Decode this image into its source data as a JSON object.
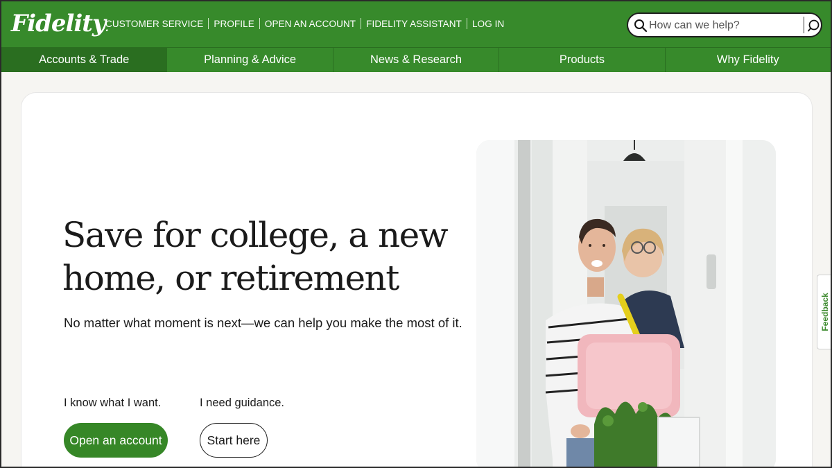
{
  "brand": {
    "logo_text": "Fidelity",
    "logo_suffix": ".",
    "green": "#378a2b",
    "dark_green": "#2a6e20"
  },
  "utility_nav": [
    {
      "label": "CUSTOMER SERVICE"
    },
    {
      "label": "PROFILE"
    },
    {
      "label": "OPEN AN ACCOUNT"
    },
    {
      "label": "FIDELITY ASSISTANT"
    },
    {
      "label": "LOG IN"
    }
  ],
  "search": {
    "placeholder": "How can we help?",
    "icon": "search-icon",
    "chat_icon": "chat-icon"
  },
  "main_nav": [
    {
      "label": "Accounts & Trade",
      "active": true
    },
    {
      "label": "Planning & Advice",
      "active": false
    },
    {
      "label": "News & Research",
      "active": false
    },
    {
      "label": "Products",
      "active": false
    },
    {
      "label": "Why Fidelity",
      "active": false
    }
  ],
  "hero": {
    "headline_line1": "Save for college, a new",
    "headline_line2": "home, or retirement",
    "subheadline": "No matter what moment is next—we can help you make the most of it.",
    "left_label": "I know what I want.",
    "right_label": "I need guidance.",
    "primary_button": "Open an account",
    "secondary_button": "Start here",
    "image_description": "hero-photo"
  },
  "feedback_tab": {
    "label": "Feedback"
  }
}
